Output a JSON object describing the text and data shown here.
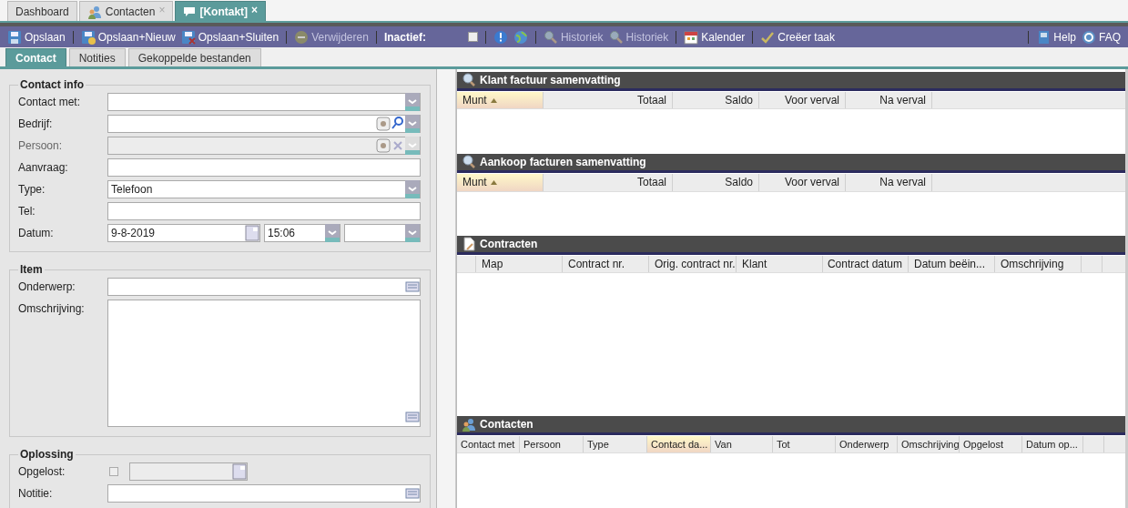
{
  "document_tabs": [
    {
      "label": "Dashboard",
      "selected": false
    },
    {
      "label": "Contacten",
      "selected": false,
      "close": "×"
    },
    {
      "label": "[Kontakt]",
      "selected": true,
      "close": "×"
    }
  ],
  "toolbar": {
    "items": [
      {
        "kind": "button",
        "label": "Opslaan",
        "disabled": false
      },
      {
        "kind": "separator"
      },
      {
        "kind": "button",
        "label": "Opslaan+Nieuw",
        "disabled": false
      },
      {
        "kind": "button",
        "label": "Opslaan+Sluiten",
        "disabled": false
      },
      {
        "kind": "separator"
      },
      {
        "kind": "button",
        "label": "Verwijderen",
        "disabled": true
      },
      {
        "kind": "separator"
      },
      {
        "kind": "checkbox",
        "label": "Inactief:",
        "checked": false
      },
      {
        "kind": "separator"
      },
      {
        "kind": "icon_button"
      },
      {
        "kind": "icon_button"
      },
      {
        "kind": "separator"
      },
      {
        "kind": "button",
        "label": "Historiek",
        "disabled": true
      },
      {
        "kind": "button",
        "label": "Historiek",
        "disabled": true
      },
      {
        "kind": "separator"
      },
      {
        "kind": "button",
        "label": "Kalender",
        "disabled": false
      },
      {
        "kind": "separator"
      },
      {
        "kind": "button",
        "label": "Creëer taak",
        "disabled": false
      },
      {
        "kind": "spacer"
      },
      {
        "kind": "separator"
      },
      {
        "kind": "button",
        "label": "Help",
        "disabled": false
      },
      {
        "kind": "button",
        "label": "FAQ",
        "disabled": false
      }
    ]
  },
  "sub_tabs": [
    {
      "label": "Contact",
      "selected": true
    },
    {
      "label": "Notities",
      "selected": false
    },
    {
      "label": "Gekoppelde bestanden",
      "selected": false
    }
  ],
  "sections": [
    {
      "title": "Contact info",
      "fields": [
        {
          "label": "Contact met:",
          "kind": "combo",
          "disabled": false
        },
        {
          "label": "Bedrijf:",
          "kind": "lookup",
          "disabled": false
        },
        {
          "label": "Persoon:",
          "kind": "lookup",
          "disabled": true
        },
        {
          "label": "Aanvraag:",
          "kind": "text",
          "disabled": false
        },
        {
          "label": "Type:",
          "kind": "combo",
          "value": "Telefoon",
          "disabled": false
        },
        {
          "label": "Tel:",
          "kind": "text",
          "disabled": false
        },
        {
          "label": "Datum:",
          "kind": "datetime",
          "value": "9-8-2019",
          "time": "15:06",
          "disabled": false
        }
      ]
    },
    {
      "title": "Item",
      "fields": [
        {
          "label": "Onderwerp:",
          "kind": "memo_line",
          "disabled": false
        },
        {
          "label": "Omschrijving:",
          "kind": "memo",
          "disabled": false
        }
      ]
    },
    {
      "title": "Oplossing",
      "fields": [
        {
          "label": "Opgelost:",
          "kind": "check_date",
          "checked": false,
          "disabled": true
        },
        {
          "label": "Notitie:",
          "kind": "memo_line",
          "disabled": false
        }
      ]
    }
  ],
  "panels": [
    {
      "title": "Klant factuur samenvatting",
      "kind": "invoice",
      "columns": [
        {
          "label": "Munt",
          "sorted": true
        },
        {
          "label": "Totaal"
        },
        {
          "label": "Saldo"
        },
        {
          "label": "Voor verval"
        },
        {
          "label": "Na verval"
        }
      ]
    },
    {
      "title": "Aankoop facturen samenvatting",
      "kind": "invoice",
      "columns": [
        {
          "label": "Munt",
          "sorted": true
        },
        {
          "label": "Totaal"
        },
        {
          "label": "Saldo"
        },
        {
          "label": "Voor verval"
        },
        {
          "label": "Na verval"
        }
      ]
    },
    {
      "title": "Contracten",
      "kind": "contract",
      "columns": [
        {
          "label": "Map"
        },
        {
          "label": "Contract nr."
        },
        {
          "label": "Orig. contract nr."
        },
        {
          "label": "Klant"
        },
        {
          "label": "Contract datum"
        },
        {
          "label": "Datum beëin..."
        },
        {
          "label": "Omschrijving"
        }
      ]
    },
    {
      "title": "Contacten",
      "kind": "contact",
      "columns": [
        {
          "label": "Contact met"
        },
        {
          "label": "Persoon"
        },
        {
          "label": "Type"
        },
        {
          "label": "Contact da...",
          "highlighted": true
        },
        {
          "label": "Van"
        },
        {
          "label": "Tot"
        },
        {
          "label": "Onderwerp"
        },
        {
          "label": "Omschrijving"
        },
        {
          "label": "Opgelost"
        },
        {
          "label": "Datum op..."
        }
      ]
    }
  ]
}
